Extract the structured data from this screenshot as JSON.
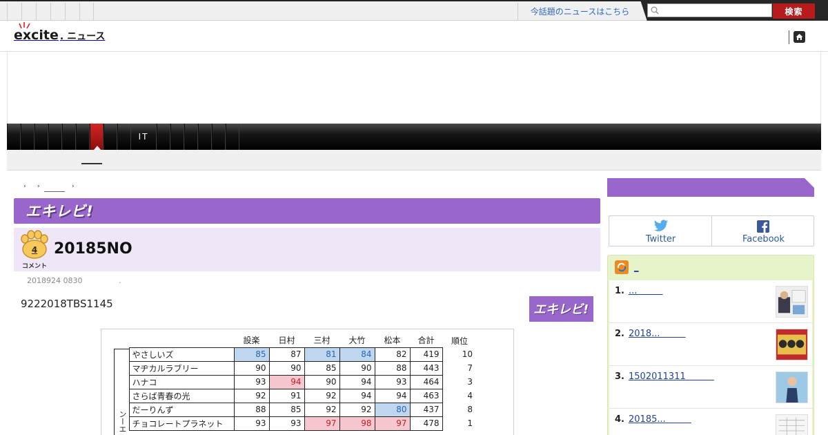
{
  "header": {
    "hot_news_link": "今話題のニュースはこちら",
    "search_placeholder": "",
    "search_button": "検索",
    "logo_text": "excite",
    "logo_suffix": ". ニュース"
  },
  "nav": {
    "it_tab": "IT"
  },
  "breadcrumb": {
    "separators": [
      "›",
      "›",
      "›"
    ]
  },
  "article": {
    "series_logo": "エキレビ!",
    "comment_count": "4",
    "comment_label": "コメント",
    "title": "20185NO",
    "date": "2018924 0830",
    "date_dot": ".",
    "lead": "9222018TBS1145",
    "tag_badge": "エキレビ!"
  },
  "score_table": {
    "columns": [
      "設楽",
      "日村",
      "三村",
      "大竹",
      "松本",
      "合計",
      "順位"
    ],
    "side_label": "ンーエ",
    "rows": [
      {
        "name": "やさしいズ",
        "scores": [
          "85",
          "87",
          "81",
          "84",
          "82"
        ],
        "total": "419",
        "rank": "10",
        "low": [
          0,
          2,
          3
        ],
        "high": []
      },
      {
        "name": "マヂカルラブリー",
        "scores": [
          "90",
          "90",
          "85",
          "90",
          "88"
        ],
        "total": "443",
        "rank": "7",
        "low": [],
        "high": []
      },
      {
        "name": "ハナコ",
        "scores": [
          "93",
          "94",
          "90",
          "94",
          "93"
        ],
        "total": "464",
        "rank": "3",
        "low": [],
        "high": [
          1
        ]
      },
      {
        "name": "さらば青春の光",
        "scores": [
          "92",
          "91",
          "92",
          "94",
          "94"
        ],
        "total": "463",
        "rank": "4",
        "low": [],
        "high": []
      },
      {
        "name": "だーりんず",
        "scores": [
          "88",
          "85",
          "92",
          "92",
          "80"
        ],
        "total": "437",
        "rank": "8",
        "low": [
          4
        ],
        "high": []
      },
      {
        "name": "チョコレートプラネット",
        "scores": [
          "93",
          "93",
          "97",
          "98",
          "97"
        ],
        "total": "478",
        "rank": "1",
        "low": [],
        "high": [
          2,
          3,
          4
        ]
      }
    ]
  },
  "sidebar": {
    "share": {
      "twitter": "Twitter",
      "facebook": "Facebook"
    },
    "ranking_title": "_",
    "ranking": [
      {
        "num": "1.",
        "title": "...         "
      },
      {
        "num": "2.",
        "title": "2018...         "
      },
      {
        "num": "3.",
        "title": "1502011311          "
      },
      {
        "num": "4.",
        "title": "20185...         "
      }
    ]
  },
  "colors": {
    "purple": "#9966cc",
    "search_red": "#b71b1b",
    "nav_active": "#c41e1e",
    "low_score": "#bfd6ef",
    "high_score": "#f6c7ce"
  }
}
